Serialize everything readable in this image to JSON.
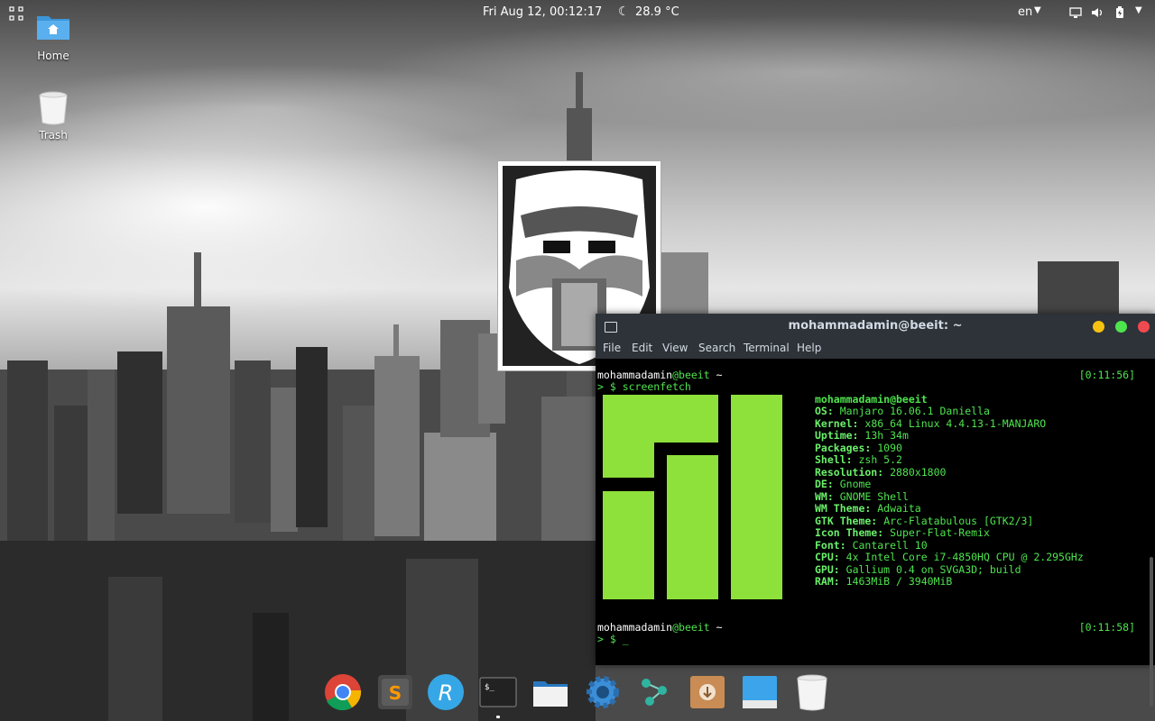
{
  "topbar": {
    "clock": "Fri Aug 12, 00:12:17",
    "temperature": "28.9 °C",
    "language": "en"
  },
  "desktop": {
    "icons": [
      {
        "label": "Home",
        "icon": "home-folder-icon"
      },
      {
        "label": "Trash",
        "icon": "trash-icon"
      }
    ]
  },
  "terminal": {
    "title": "mohammadamin@beeit: ~",
    "menu": [
      "File",
      "Edit",
      "View",
      "Search",
      "Terminal",
      "Help"
    ],
    "prompt1": {
      "user": "mohammadamin",
      "host": "@beeit",
      "dir": " ~",
      "command": "> $ screenfetch",
      "time": "[0:11:56]"
    },
    "info_header": "mohammadamin@beeit",
    "info": [
      {
        "key": "OS:",
        "value": "Manjaro 16.06.1 Daniella"
      },
      {
        "key": "Kernel:",
        "value": "x86_64 Linux 4.4.13-1-MANJARO"
      },
      {
        "key": "Uptime:",
        "value": "13h 34m"
      },
      {
        "key": "Packages:",
        "value": "1090"
      },
      {
        "key": "Shell:",
        "value": "zsh 5.2"
      },
      {
        "key": "Resolution:",
        "value": "2880x1800"
      },
      {
        "key": "DE:",
        "value": "Gnome"
      },
      {
        "key": "WM:",
        "value": "GNOME Shell"
      },
      {
        "key": "WM Theme:",
        "value": "Adwaita"
      },
      {
        "key": "GTK Theme:",
        "value": "Arc-Flatabulous [GTK2/3]"
      },
      {
        "key": "Icon Theme:",
        "value": "Super-Flat-Remix"
      },
      {
        "key": "Font:",
        "value": "Cantarell 10"
      },
      {
        "key": "CPU:",
        "value": "4x Intel Core i7-4850HQ CPU @ 2.295GHz"
      },
      {
        "key": "GPU:",
        "value": "Gallium 0.4 on SVGA3D; build"
      },
      {
        "key": "RAM:",
        "value": "1463MiB / 3940MiB"
      }
    ],
    "prompt2": {
      "user": "mohammadamin",
      "host": "@beeit",
      "dir": " ~",
      "command": "> $ _",
      "time": "[0:11:58]"
    }
  },
  "dock": {
    "items": [
      "chrome-icon",
      "sublime-text-icon",
      "r-studio-icon",
      "terminal-icon",
      "files-icon",
      "settings-icon",
      "network-icon",
      "archive-manager-icon",
      "window-icon",
      "trash-icon"
    ]
  },
  "colors": {
    "terminal_green": "#4ee44e",
    "manjaro_green": "#8ee03a",
    "titlebar": "#2e3339",
    "close": "#f04a50",
    "maximize": "#4ee44e",
    "minimize": "#f5c211"
  }
}
